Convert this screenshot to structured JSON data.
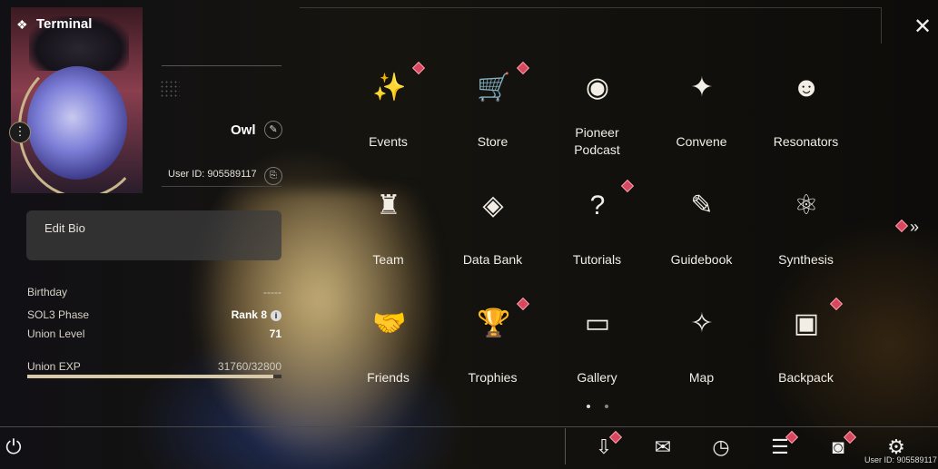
{
  "window": {
    "title": "Terminal"
  },
  "profile": {
    "name": "Owl",
    "user_id": "User ID: 905589117",
    "bio_label": "Edit Bio",
    "stats": [
      {
        "label": "Birthday",
        "value": "-----"
      },
      {
        "label": "SOL3 Phase",
        "value": "Rank 8"
      },
      {
        "label": "Union Level",
        "value": "71"
      },
      {
        "label": "Union EXP",
        "value": "31760/32800"
      }
    ],
    "exp_progress": 0.968
  },
  "grid": [
    {
      "label": "Events",
      "icon": "events-icon",
      "badge": true
    },
    {
      "label": "Store",
      "icon": "cart-icon",
      "badge": true
    },
    {
      "label": "Pioneer\nPodcast",
      "icon": "podcast-icon",
      "badge": false
    },
    {
      "label": "Convene",
      "icon": "convene-icon",
      "badge": false
    },
    {
      "label": "Resonators",
      "icon": "resonators-icon",
      "badge": false
    },
    {
      "label": "Team",
      "icon": "team-icon",
      "badge": false
    },
    {
      "label": "Data Bank",
      "icon": "data-bank-icon",
      "badge": false
    },
    {
      "label": "Tutorials",
      "icon": "tutorials-icon",
      "badge": true
    },
    {
      "label": "Guidebook",
      "icon": "guidebook-icon",
      "badge": false
    },
    {
      "label": "Synthesis",
      "icon": "synthesis-icon",
      "badge": false
    },
    {
      "label": "Friends",
      "icon": "handshake-icon",
      "badge": false
    },
    {
      "label": "Trophies",
      "icon": "trophy-icon",
      "badge": true
    },
    {
      "label": "Gallery",
      "icon": "gallery-icon",
      "badge": false
    },
    {
      "label": "Map",
      "icon": "compass-icon",
      "badge": false
    },
    {
      "label": "Backpack",
      "icon": "backpack-icon",
      "badge": true
    }
  ],
  "bottom_bar": {
    "user_id": "User ID: 905589117",
    "icons": [
      "download-icon",
      "mail-icon",
      "clock-icon",
      "notes-icon",
      "camera-icon",
      "settings-icon"
    ]
  },
  "colors": {
    "badge": "#d9475f",
    "text": "#f2eee6",
    "accent": "#c9b58a"
  }
}
